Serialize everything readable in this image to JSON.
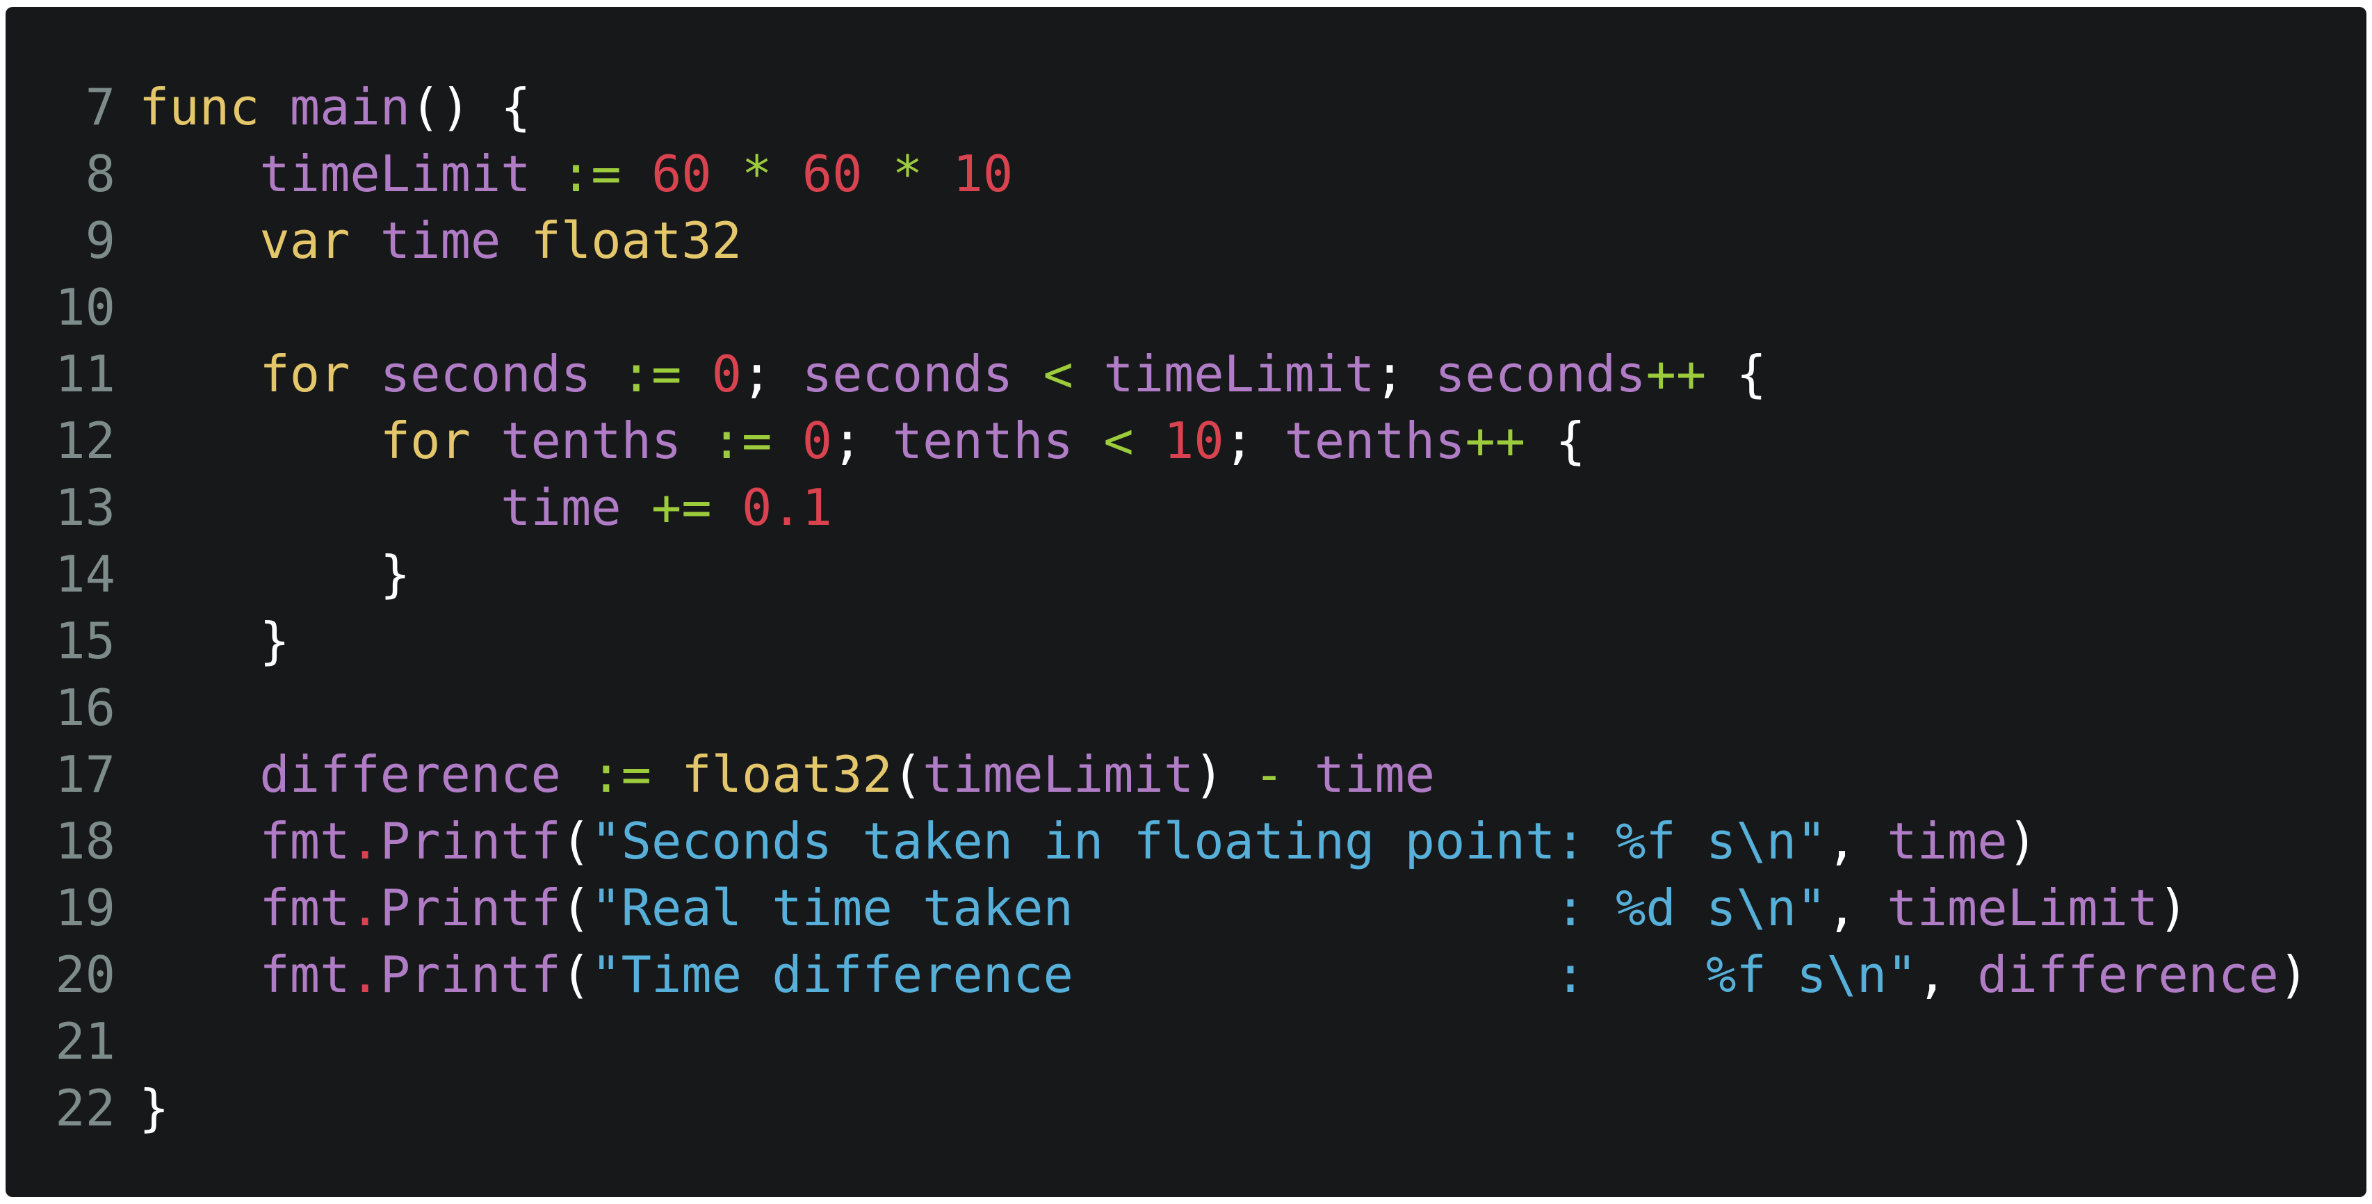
{
  "colors": {
    "background": "#17181a",
    "line_number": "#7d8c8a",
    "plain": "#e6e6e6",
    "keyword": "#e5c76b",
    "identifier": "#b07cc6",
    "operator": "#9ccc3b",
    "number": "#d9434f",
    "string": "#56b0da",
    "punct": "#ffffff"
  },
  "lines": [
    {
      "n": "7",
      "tokens": [
        {
          "t": "func",
          "c": "keyword"
        },
        {
          "t": " ",
          "c": "plain"
        },
        {
          "t": "main",
          "c": "identifier"
        },
        {
          "t": "() {",
          "c": "punct"
        }
      ]
    },
    {
      "n": "8",
      "tokens": [
        {
          "t": "    ",
          "c": "plain"
        },
        {
          "t": "timeLimit",
          "c": "identifier"
        },
        {
          "t": " ",
          "c": "plain"
        },
        {
          "t": ":=",
          "c": "operator"
        },
        {
          "t": " ",
          "c": "plain"
        },
        {
          "t": "60",
          "c": "number"
        },
        {
          "t": " ",
          "c": "plain"
        },
        {
          "t": "*",
          "c": "operator"
        },
        {
          "t": " ",
          "c": "plain"
        },
        {
          "t": "60",
          "c": "number"
        },
        {
          "t": " ",
          "c": "plain"
        },
        {
          "t": "*",
          "c": "operator"
        },
        {
          "t": " ",
          "c": "plain"
        },
        {
          "t": "10",
          "c": "number"
        }
      ]
    },
    {
      "n": "9",
      "tokens": [
        {
          "t": "    ",
          "c": "plain"
        },
        {
          "t": "var",
          "c": "keyword"
        },
        {
          "t": " ",
          "c": "plain"
        },
        {
          "t": "time",
          "c": "identifier"
        },
        {
          "t": " ",
          "c": "plain"
        },
        {
          "t": "float32",
          "c": "keyword"
        }
      ]
    },
    {
      "n": "10",
      "tokens": []
    },
    {
      "n": "11",
      "tokens": [
        {
          "t": "    ",
          "c": "plain"
        },
        {
          "t": "for",
          "c": "keyword"
        },
        {
          "t": " ",
          "c": "plain"
        },
        {
          "t": "seconds",
          "c": "identifier"
        },
        {
          "t": " ",
          "c": "plain"
        },
        {
          "t": ":=",
          "c": "operator"
        },
        {
          "t": " ",
          "c": "plain"
        },
        {
          "t": "0",
          "c": "number"
        },
        {
          "t": "; ",
          "c": "punct"
        },
        {
          "t": "seconds",
          "c": "identifier"
        },
        {
          "t": " ",
          "c": "plain"
        },
        {
          "t": "<",
          "c": "operator"
        },
        {
          "t": " ",
          "c": "plain"
        },
        {
          "t": "timeLimit",
          "c": "identifier"
        },
        {
          "t": "; ",
          "c": "punct"
        },
        {
          "t": "seconds",
          "c": "identifier"
        },
        {
          "t": "++",
          "c": "operator"
        },
        {
          "t": " {",
          "c": "punct"
        }
      ]
    },
    {
      "n": "12",
      "tokens": [
        {
          "t": "        ",
          "c": "plain"
        },
        {
          "t": "for",
          "c": "keyword"
        },
        {
          "t": " ",
          "c": "plain"
        },
        {
          "t": "tenths",
          "c": "identifier"
        },
        {
          "t": " ",
          "c": "plain"
        },
        {
          "t": ":=",
          "c": "operator"
        },
        {
          "t": " ",
          "c": "plain"
        },
        {
          "t": "0",
          "c": "number"
        },
        {
          "t": "; ",
          "c": "punct"
        },
        {
          "t": "tenths",
          "c": "identifier"
        },
        {
          "t": " ",
          "c": "plain"
        },
        {
          "t": "<",
          "c": "operator"
        },
        {
          "t": " ",
          "c": "plain"
        },
        {
          "t": "10",
          "c": "number"
        },
        {
          "t": "; ",
          "c": "punct"
        },
        {
          "t": "tenths",
          "c": "identifier"
        },
        {
          "t": "++",
          "c": "operator"
        },
        {
          "t": " {",
          "c": "punct"
        }
      ]
    },
    {
      "n": "13",
      "tokens": [
        {
          "t": "            ",
          "c": "plain"
        },
        {
          "t": "time",
          "c": "identifier"
        },
        {
          "t": " ",
          "c": "plain"
        },
        {
          "t": "+=",
          "c": "operator"
        },
        {
          "t": " ",
          "c": "plain"
        },
        {
          "t": "0.1",
          "c": "number"
        }
      ]
    },
    {
      "n": "14",
      "tokens": [
        {
          "t": "        ",
          "c": "plain"
        },
        {
          "t": "}",
          "c": "punct"
        }
      ]
    },
    {
      "n": "15",
      "tokens": [
        {
          "t": "    ",
          "c": "plain"
        },
        {
          "t": "}",
          "c": "punct"
        }
      ]
    },
    {
      "n": "16",
      "tokens": []
    },
    {
      "n": "17",
      "tokens": [
        {
          "t": "    ",
          "c": "plain"
        },
        {
          "t": "difference",
          "c": "identifier"
        },
        {
          "t": " ",
          "c": "plain"
        },
        {
          "t": ":=",
          "c": "operator"
        },
        {
          "t": " ",
          "c": "plain"
        },
        {
          "t": "float32",
          "c": "keyword"
        },
        {
          "t": "(",
          "c": "punct"
        },
        {
          "t": "timeLimit",
          "c": "identifier"
        },
        {
          "t": ") ",
          "c": "punct"
        },
        {
          "t": "-",
          "c": "operator"
        },
        {
          "t": " ",
          "c": "plain"
        },
        {
          "t": "time",
          "c": "identifier"
        }
      ]
    },
    {
      "n": "18",
      "tokens": [
        {
          "t": "    ",
          "c": "plain"
        },
        {
          "t": "fmt",
          "c": "identifier"
        },
        {
          "t": ".",
          "c": "number"
        },
        {
          "t": "Printf",
          "c": "identifier"
        },
        {
          "t": "(",
          "c": "punct"
        },
        {
          "t": "\"Seconds taken in floating point: %f s\\n\"",
          "c": "string"
        },
        {
          "t": ", ",
          "c": "punct"
        },
        {
          "t": "time",
          "c": "identifier"
        },
        {
          "t": ")",
          "c": "punct"
        }
      ]
    },
    {
      "n": "19",
      "tokens": [
        {
          "t": "    ",
          "c": "plain"
        },
        {
          "t": "fmt",
          "c": "identifier"
        },
        {
          "t": ".",
          "c": "number"
        },
        {
          "t": "Printf",
          "c": "identifier"
        },
        {
          "t": "(",
          "c": "punct"
        },
        {
          "t": "\"Real time taken                : %d s\\n\"",
          "c": "string"
        },
        {
          "t": ", ",
          "c": "punct"
        },
        {
          "t": "timeLimit",
          "c": "identifier"
        },
        {
          "t": ")",
          "c": "punct"
        }
      ]
    },
    {
      "n": "20",
      "tokens": [
        {
          "t": "    ",
          "c": "plain"
        },
        {
          "t": "fmt",
          "c": "identifier"
        },
        {
          "t": ".",
          "c": "number"
        },
        {
          "t": "Printf",
          "c": "identifier"
        },
        {
          "t": "(",
          "c": "punct"
        },
        {
          "t": "\"Time difference                :    %f s\\n\"",
          "c": "string"
        },
        {
          "t": ", ",
          "c": "punct"
        },
        {
          "t": "difference",
          "c": "identifier"
        },
        {
          "t": ")",
          "c": "punct"
        }
      ]
    },
    {
      "n": "21",
      "tokens": []
    },
    {
      "n": "22",
      "tokens": [
        {
          "t": "}",
          "c": "punct"
        }
      ]
    }
  ]
}
